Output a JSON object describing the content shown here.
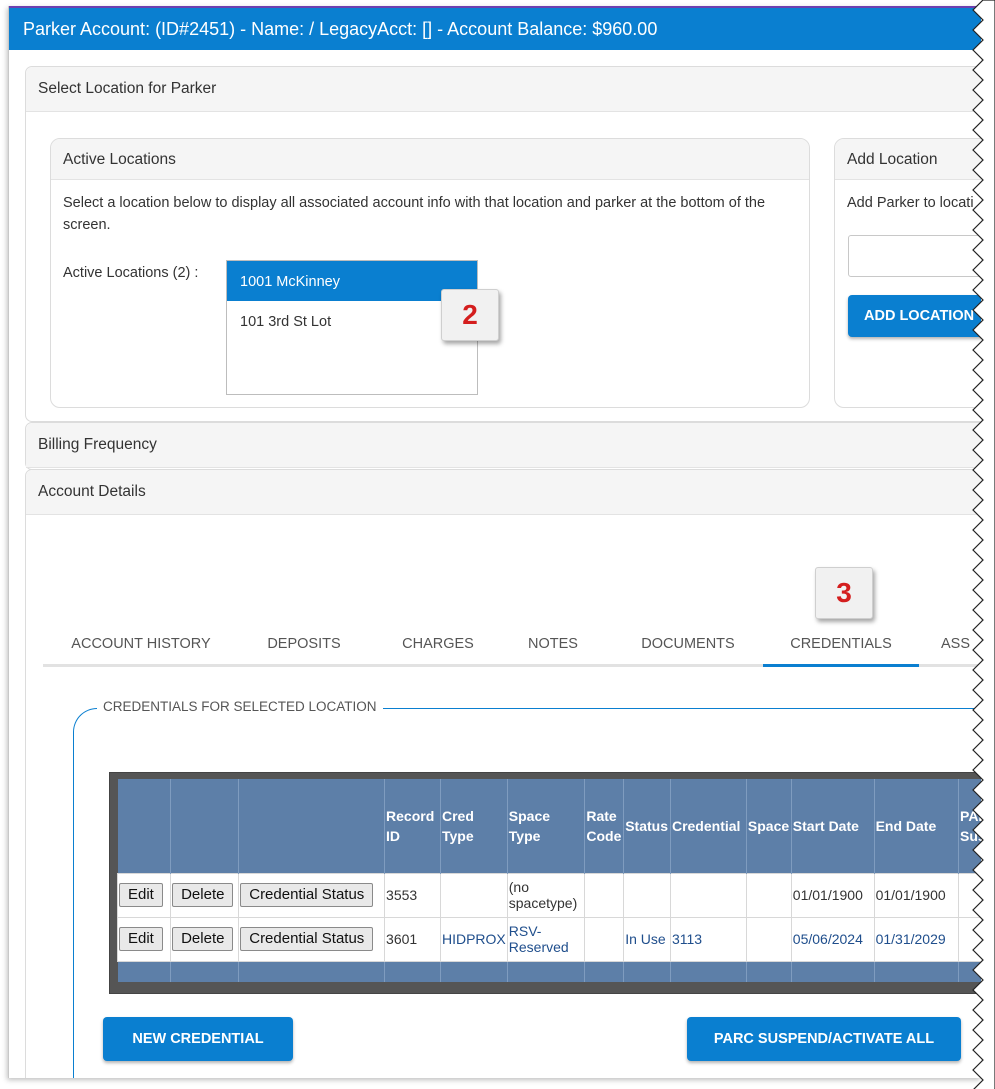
{
  "header": {
    "title": "Parker Account: (ID#2451) - Name: / LegacyAcct: [] - Account Balance: $960.00"
  },
  "select_location_panel": {
    "title": "Select Location for Parker"
  },
  "active_locations": {
    "title": "Active Locations",
    "description": "Select a location below to display all associated account info with that location and parker at the bottom of the screen.",
    "list_label": "Active Locations (2) :",
    "items": [
      "1001 McKinney",
      "101 3rd St Lot"
    ],
    "selected": "1001 McKinney"
  },
  "add_location": {
    "title": "Add Location",
    "description": "Add Parker to locati",
    "input_value": "",
    "button_label": "ADD LOCATION"
  },
  "callouts": [
    "2",
    "3"
  ],
  "billing_panel": {
    "title": "Billing Frequency"
  },
  "account_details_panel": {
    "title": "Account Details"
  },
  "tabs": [
    "ACCOUNT HISTORY",
    "DEPOSITS",
    "CHARGES",
    "NOTES",
    "DOCUMENTS",
    "CREDENTIALS",
    "ASS"
  ],
  "active_tab": "CREDENTIALS",
  "credentials": {
    "section_title": "CREDENTIALS FOR SELECTED LOCATION",
    "columns": [
      "",
      "",
      "",
      "Record ID",
      "Cred Type",
      "Space Type",
      "Rate Code",
      "Status",
      "Credential",
      "Space",
      "Start Date",
      "End Date",
      "PAR Sus"
    ],
    "row_buttons": {
      "edit": "Edit",
      "delete": "Delete",
      "status": "Credential Status"
    },
    "rows": [
      {
        "record_id": "3553",
        "cred_type": "",
        "space_type": "(no spacetype)",
        "rate_code": "",
        "status": "",
        "credential": "",
        "space": "",
        "start_date": "01/01/1900",
        "end_date": "01/01/1900"
      },
      {
        "record_id": "3601",
        "cred_type": "HIDPROX",
        "space_type": "RSV-Reserved",
        "rate_code": "",
        "status": "In Use",
        "credential": "3113",
        "space": "",
        "start_date": "05/06/2024",
        "end_date": "01/31/2029"
      }
    ],
    "new_button": "NEW CREDENTIAL",
    "suspend_button": "PARC SUSPEND/ACTIVATE ALL"
  }
}
